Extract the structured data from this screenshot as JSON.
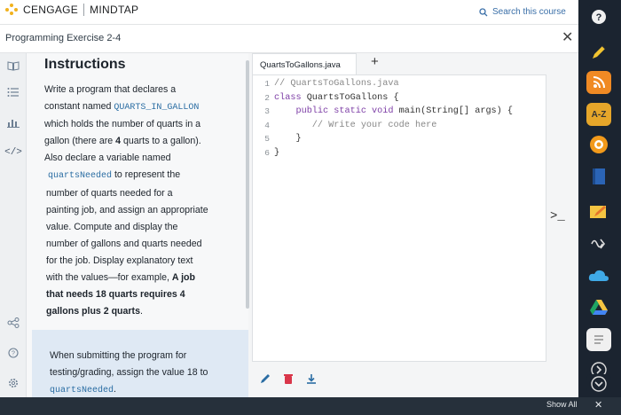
{
  "topbar": {
    "brand": "CENGAGE",
    "product": "MINDTAP",
    "search_placeholder": "Search this course"
  },
  "header": {
    "breadcrumb": "Programming Exercise 2-4"
  },
  "instructions": {
    "title": "Instructions",
    "p1": "Write a program that declares a",
    "p2a": "constant named ",
    "p2code": "QUARTS_IN_GALLON",
    "p3": "which holds the number of quarts in a",
    "p4a": "gallon (there are ",
    "p4b": "4",
    "p4c": " quarts to a gallon).",
    "p5": "Also declare a variable named",
    "p6code": "quartsNeeded",
    "p6b": " to represent the",
    "p7": "number of quarts needed for a",
    "p8": "painting job, and assign an appropriate",
    "p9": "value. Compute and display the",
    "p10": "number of gallons and quarts needed",
    "p11": "for the job. Display explanatory text",
    "p12a": "with the values—for example, ",
    "p12b": "A job",
    "p13": "that needs 18 quarts requires 4",
    "p14": "gallons plus 2 quarts",
    "p14end": ".",
    "note1": "When submitting the program for",
    "note2": "testing/grading, assign the value 18 to",
    "note3code": "quartsNeeded",
    "note3end": "."
  },
  "editor": {
    "tab_label": "QuartsToGallons.java",
    "add_tab": "+",
    "line_numbers": [
      "1",
      "2",
      "3",
      "4",
      "5",
      "6"
    ],
    "lines": [
      {
        "prefix": "",
        "kw": "",
        "text": "// QuartsToGallons.java",
        "comment": true
      },
      {
        "prefix": "",
        "kw": "class",
        "text": " QuartsToGallons {",
        "comment": false
      },
      {
        "prefix": "    ",
        "kw": "public static void",
        "text": " main(String[] args) {",
        "comment": false
      },
      {
        "prefix": "       ",
        "kw": "",
        "text": "// Write your code here",
        "comment": true
      },
      {
        "prefix": "    ",
        "kw": "",
        "text": "}",
        "comment": false
      },
      {
        "prefix": "",
        "kw": "",
        "text": "}",
        "comment": false
      }
    ],
    "terminal_prompt": ">_"
  },
  "dock": {
    "items": [
      "rss-icon",
      "a-z-icon",
      "bullseye-icon",
      "book-icon",
      "pencil-icon",
      "sound-icon",
      "cloud-icon",
      "drive-icon",
      "notes-icon",
      "chevron-right-icon",
      "chevron-down-icon"
    ]
  },
  "bottombar": {
    "show_all": "Show All",
    "close": "✕"
  },
  "colors": {
    "accent": "#2a6da3",
    "keyword": "#7d3ea6",
    "note_bg": "#dfe9f4",
    "delete_red": "#d9364a"
  }
}
